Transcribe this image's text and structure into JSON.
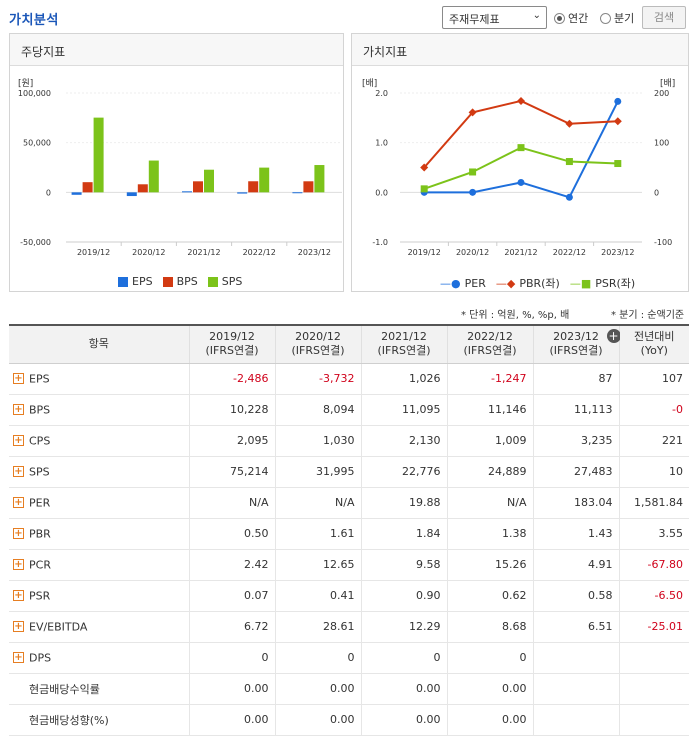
{
  "header": {
    "title": "가치분석",
    "select_value": "주재무제표",
    "radio_annual": "연간",
    "radio_quarter": "분기",
    "search_label": "검색"
  },
  "left_panel": {
    "title": "주당지표",
    "unit": "[원]"
  },
  "right_panel": {
    "title": "가치지표",
    "unit_left": "[배]",
    "unit_right": "[배]"
  },
  "chart_data": [
    {
      "type": "bar",
      "title": "주당지표",
      "ylabel": "[원]",
      "ylim": [
        -50000,
        100000
      ],
      "yticks": [
        "100,000",
        "50,000",
        "0",
        "-50,000"
      ],
      "categories": [
        "2019/12",
        "2020/12",
        "2021/12",
        "2022/12",
        "2023/12"
      ],
      "series": [
        {
          "name": "EPS",
          "color": "#1e6fdc",
          "values": [
            -2486,
            -3732,
            1026,
            -1247,
            87
          ]
        },
        {
          "name": "BPS",
          "color": "#d23a12",
          "values": [
            10228,
            8094,
            11095,
            11146,
            11113
          ]
        },
        {
          "name": "SPS",
          "color": "#7cc31a",
          "values": [
            75214,
            31995,
            22776,
            24889,
            27483
          ]
        }
      ],
      "legend": "bottom"
    },
    {
      "type": "line",
      "title": "가치지표",
      "ylim_left": [
        -1.0,
        2.0
      ],
      "yticks_left": [
        "2.0",
        "1.0",
        "0.0",
        "-1.0"
      ],
      "ylim_right": [
        -100,
        200
      ],
      "yticks_right": [
        "200",
        "100",
        "0",
        "-100"
      ],
      "categories": [
        "2019/12",
        "2020/12",
        "2021/12",
        "2022/12",
        "2023/12"
      ],
      "series": [
        {
          "name": "PER",
          "axis": "right",
          "color": "#1e6fdc",
          "values": [
            0,
            0,
            19.88,
            0,
            183.04
          ]
        },
        {
          "name": "PBR(좌)",
          "axis": "left",
          "color": "#d23a12",
          "values": [
            0.5,
            1.61,
            1.84,
            1.38,
            1.43
          ]
        },
        {
          "name": "PSR(좌)",
          "axis": "left",
          "color": "#7cc31a",
          "values": [
            0.07,
            0.41,
            0.9,
            0.62,
            0.58
          ]
        }
      ],
      "legend": "bottom"
    }
  ],
  "notes": {
    "unit": "* 단위 : 억원, %, %p, 배",
    "period": "* 분기 : 순액기준"
  },
  "table": {
    "headers": [
      {
        "l1": "항목",
        "l2": ""
      },
      {
        "l1": "2019/12",
        "l2": "(IFRS연결)"
      },
      {
        "l1": "2020/12",
        "l2": "(IFRS연결)"
      },
      {
        "l1": "2021/12",
        "l2": "(IFRS연결)"
      },
      {
        "l1": "2022/12",
        "l2": "(IFRS연결)"
      },
      {
        "l1": "2023/12",
        "l2": "(IFRS연결)"
      },
      {
        "l1": "전년대비",
        "l2": "(YoY)"
      }
    ],
    "rows": [
      {
        "label": "EPS",
        "expand": true,
        "cells": [
          "-2,486",
          "-3,732",
          "1,026",
          "-1,247",
          "87",
          "107"
        ]
      },
      {
        "label": "BPS",
        "expand": true,
        "cells": [
          "10,228",
          "8,094",
          "11,095",
          "11,146",
          "11,113",
          "-0"
        ]
      },
      {
        "label": "CPS",
        "expand": true,
        "cells": [
          "2,095",
          "1,030",
          "2,130",
          "1,009",
          "3,235",
          "221"
        ]
      },
      {
        "label": "SPS",
        "expand": true,
        "cells": [
          "75,214",
          "31,995",
          "22,776",
          "24,889",
          "27,483",
          "10"
        ]
      },
      {
        "label": "PER",
        "expand": true,
        "cells": [
          "N/A",
          "N/A",
          "19.88",
          "N/A",
          "183.04",
          "1,581.84"
        ]
      },
      {
        "label": "PBR",
        "expand": true,
        "cells": [
          "0.50",
          "1.61",
          "1.84",
          "1.38",
          "1.43",
          "3.55"
        ]
      },
      {
        "label": "PCR",
        "expand": true,
        "cells": [
          "2.42",
          "12.65",
          "9.58",
          "15.26",
          "4.91",
          "-67.80"
        ]
      },
      {
        "label": "PSR",
        "expand": true,
        "cells": [
          "0.07",
          "0.41",
          "0.90",
          "0.62",
          "0.58",
          "-6.50"
        ]
      },
      {
        "label": "EV/EBITDA",
        "expand": true,
        "cells": [
          "6.72",
          "28.61",
          "12.29",
          "8.68",
          "6.51",
          "-25.01"
        ]
      },
      {
        "label": "DPS",
        "expand": true,
        "cells": [
          "0",
          "0",
          "0",
          "0",
          "",
          ""
        ]
      },
      {
        "label": "현금배당수익률",
        "expand": false,
        "cells": [
          "0.00",
          "0.00",
          "0.00",
          "0.00",
          "",
          ""
        ]
      },
      {
        "label": "현금배당성향(%)",
        "expand": false,
        "cells": [
          "0.00",
          "0.00",
          "0.00",
          "0.00",
          "",
          ""
        ]
      }
    ]
  }
}
